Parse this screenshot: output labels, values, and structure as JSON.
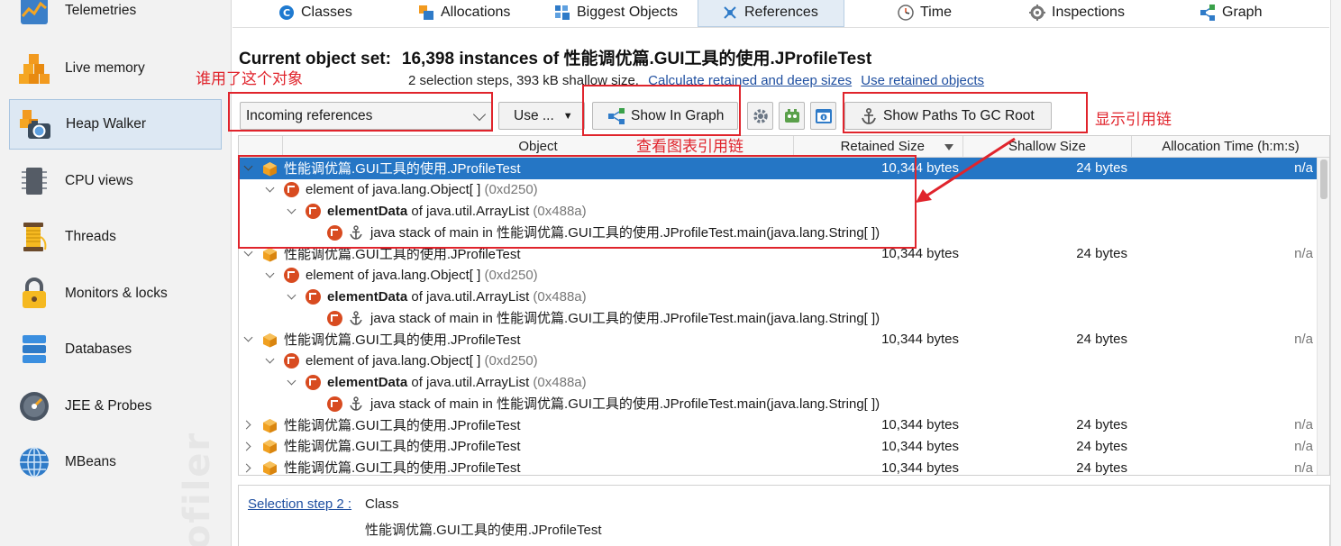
{
  "sidebar": {
    "items": [
      {
        "label": "Telemetries",
        "icon": "telemetries-icon"
      },
      {
        "label": "Live memory",
        "icon": "live-memory-icon"
      },
      {
        "label": "Heap Walker",
        "icon": "heap-walker-icon",
        "active": true
      },
      {
        "label": "CPU views",
        "icon": "cpu-views-icon"
      },
      {
        "label": "Threads",
        "icon": "threads-icon"
      },
      {
        "label": "Monitors & locks",
        "icon": "monitors-locks-icon"
      },
      {
        "label": "Databases",
        "icon": "databases-icon"
      },
      {
        "label": "JEE & Probes",
        "icon": "jee-probes-icon"
      },
      {
        "label": "MBeans",
        "icon": "mbeans-icon"
      }
    ],
    "watermark": "ofiler"
  },
  "tabs": [
    {
      "label": "Classes",
      "icon": "classes-icon"
    },
    {
      "label": "Allocations",
      "icon": "allocations-icon"
    },
    {
      "label": "Biggest Objects",
      "icon": "biggest-objects-icon"
    },
    {
      "label": "References",
      "icon": "references-icon",
      "active": true
    },
    {
      "label": "Time",
      "icon": "time-icon"
    },
    {
      "label": "Inspections",
      "icon": "inspections-icon"
    },
    {
      "label": "Graph",
      "icon": "graph-icon"
    }
  ],
  "header": {
    "label": "Current object set:",
    "value": "16,398 instances of 性能调优篇.GUI工具的使用.JProfileTest",
    "sub": "2 selection steps, 393 kB shallow size,",
    "link1": "Calculate retained and deep sizes",
    "link2": "Use retained objects"
  },
  "toolbar": {
    "ref_select_value": "Incoming references",
    "use_label": "Use ...",
    "use_caret": "▼",
    "graph_label": "Show In Graph",
    "gc_label": "Show Paths To GC Root"
  },
  "annotations": {
    "who_refs": "谁用了这个对象",
    "graph_chain": "查看图表引用链",
    "show_chain": "显示引用链"
  },
  "table": {
    "columns": [
      "Object",
      "Retained Size",
      "Shallow Size",
      "Allocation Time (h:m:s)"
    ],
    "rows": [
      {
        "level": 0,
        "toggle": "down",
        "icon": "cube",
        "parts": [
          {
            "t": "性能调优篇.GUI工具的使用.JProfileTest"
          }
        ],
        "retained": "10,344 bytes",
        "shallow": "24 bytes",
        "time": "n/a",
        "selected": true
      },
      {
        "level": 1,
        "toggle": "down",
        "icon": "ref",
        "parts": [
          {
            "t": "element of java.lang.Object[ ] "
          },
          {
            "t": "(0xd250)",
            "c": "addr"
          }
        ]
      },
      {
        "level": 2,
        "toggle": "down",
        "icon": "ref",
        "parts": [
          {
            "t": "elementData",
            "c": "b"
          },
          {
            "t": " of java.util.ArrayList "
          },
          {
            "t": "(0x488a)",
            "c": "addr"
          }
        ]
      },
      {
        "level": 3,
        "toggle": "none",
        "icon": "ref-anchor",
        "parts": [
          {
            "t": "java stack of main in 性能调优篇.GUI工具的使用.JProfileTest.main(java.lang.String[ ])"
          }
        ]
      },
      {
        "level": 0,
        "toggle": "down",
        "icon": "cube",
        "parts": [
          {
            "t": "性能调优篇.GUI工具的使用.JProfileTest"
          }
        ],
        "retained": "10,344 bytes",
        "shallow": "24 bytes",
        "time": "n/a"
      },
      {
        "level": 1,
        "toggle": "down",
        "icon": "ref",
        "parts": [
          {
            "t": "element of java.lang.Object[ ] "
          },
          {
            "t": "(0xd250)",
            "c": "addr"
          }
        ]
      },
      {
        "level": 2,
        "toggle": "down",
        "icon": "ref",
        "parts": [
          {
            "t": "elementData",
            "c": "b"
          },
          {
            "t": " of java.util.ArrayList "
          },
          {
            "t": "(0x488a)",
            "c": "addr"
          }
        ]
      },
      {
        "level": 3,
        "toggle": "none",
        "icon": "ref-anchor",
        "parts": [
          {
            "t": "java stack of main in 性能调优篇.GUI工具的使用.JProfileTest.main(java.lang.String[ ])"
          }
        ]
      },
      {
        "level": 0,
        "toggle": "down",
        "icon": "cube",
        "parts": [
          {
            "t": "性能调优篇.GUI工具的使用.JProfileTest"
          }
        ],
        "retained": "10,344 bytes",
        "shallow": "24 bytes",
        "time": "n/a"
      },
      {
        "level": 1,
        "toggle": "down",
        "icon": "ref",
        "parts": [
          {
            "t": "element of java.lang.Object[ ] "
          },
          {
            "t": "(0xd250)",
            "c": "addr"
          }
        ]
      },
      {
        "level": 2,
        "toggle": "down",
        "icon": "ref",
        "parts": [
          {
            "t": "elementData",
            "c": "b"
          },
          {
            "t": " of java.util.ArrayList "
          },
          {
            "t": "(0x488a)",
            "c": "addr"
          }
        ]
      },
      {
        "level": 3,
        "toggle": "none",
        "icon": "ref-anchor",
        "parts": [
          {
            "t": "java stack of main in 性能调优篇.GUI工具的使用.JProfileTest.main(java.lang.String[ ])"
          }
        ]
      },
      {
        "level": 0,
        "toggle": "right",
        "icon": "cube",
        "parts": [
          {
            "t": "性能调优篇.GUI工具的使用.JProfileTest"
          }
        ],
        "retained": "10,344 bytes",
        "shallow": "24 bytes",
        "time": "n/a"
      },
      {
        "level": 0,
        "toggle": "right",
        "icon": "cube",
        "parts": [
          {
            "t": "性能调优篇.GUI工具的使用.JProfileTest"
          }
        ],
        "retained": "10,344 bytes",
        "shallow": "24 bytes",
        "time": "n/a"
      },
      {
        "level": 0,
        "toggle": "right",
        "icon": "cube",
        "parts": [
          {
            "t": "性能调优篇.GUI工具的使用.JProfileTest"
          }
        ],
        "retained": "10,344 bytes",
        "shallow": "24 bytes",
        "time": "n/a"
      }
    ]
  },
  "bottom": {
    "step_link": "Selection step 2 :",
    "step_kind": "Class",
    "step_class": "性能调优篇.GUI工具的使用.JProfileTest"
  },
  "colors": {
    "selection": "#2576c5",
    "annotation": "#e0242c",
    "link": "#1f4fa0",
    "ref_icon": "#d84b20",
    "cube": "#f0a020"
  }
}
